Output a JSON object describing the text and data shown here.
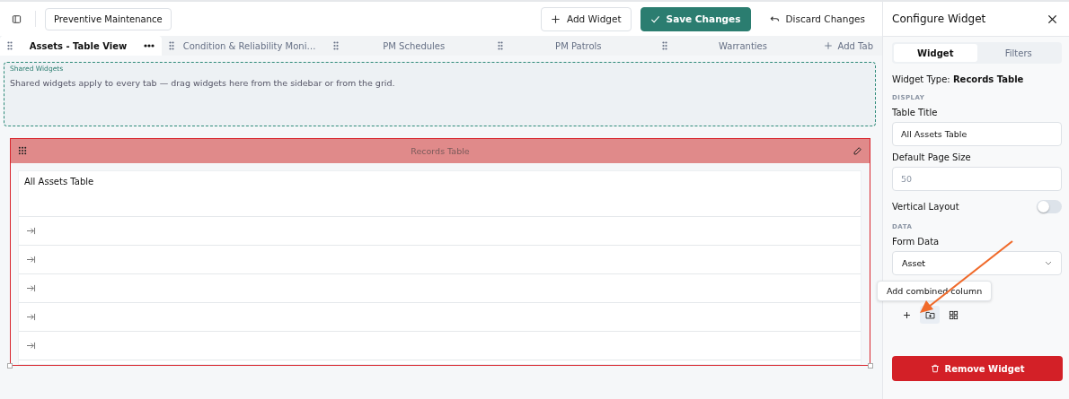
{
  "header": {
    "title_field": {
      "value": "Preventive Maintenance"
    },
    "buttons": [
      {
        "label": "Add Widget",
        "kind": "add"
      },
      {
        "label": "Save Changes",
        "kind": "save"
      },
      {
        "label": "Discard Changes",
        "kind": "discard"
      }
    ]
  },
  "tabs": [
    {
      "label": "Assets - Table View",
      "selected": true
    },
    {
      "label": "Condition & Reliability Moni…",
      "selected": false
    },
    {
      "label": "PM Schedules",
      "selected": false
    },
    {
      "label": "PM Patrols",
      "selected": false
    },
    {
      "label": "Warranties",
      "selected": false
    }
  ],
  "add_tab": "Add Tab",
  "shared_widgets": {
    "title": "Shared Widgets",
    "hint": "Shared widgets apply to every tab — drag widgets here from the sidebar or from the grid."
  },
  "widget": {
    "header": "Records Table",
    "selected": true,
    "table_title": "All Assets Table",
    "rows": [
      {
        "kind": "collapsed"
      },
      {
        "kind": "collapsed"
      },
      {
        "kind": "collapsed"
      },
      {
        "kind": "collapsed"
      },
      {
        "kind": "collapsed"
      }
    ]
  },
  "panel": {
    "title": "Configure Widget",
    "tabs": [
      {
        "label": "Widget",
        "selected": true
      },
      {
        "label": "Filters",
        "selected": false
      }
    ],
    "widget_type": "Widget Type: **Records Table**",
    "display_section": "DISPLAY",
    "table_title": {
      "label": "Table Title",
      "value": "All Assets Table"
    },
    "page_size": {
      "label": "Default Page Size",
      "placeholder": "50"
    },
    "vertical_layout": {
      "label": "Vertical Layout",
      "on": false
    },
    "data_section": "DATA",
    "form_data": {
      "label": "Form Data",
      "value": "Asset"
    },
    "tooltip": "Add combined column",
    "tools": [
      {
        "kind": "plus",
        "selected": false
      },
      {
        "kind": "folder",
        "selected": true
      },
      {
        "kind": "grid",
        "selected": false
      }
    ],
    "remove_button": "Remove Widget"
  }
}
